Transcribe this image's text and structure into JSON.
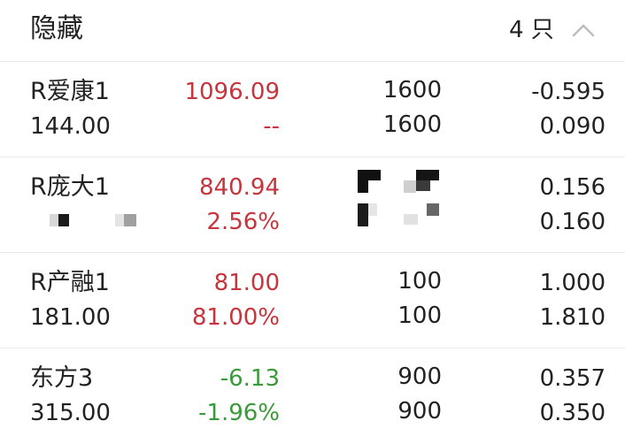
{
  "header": {
    "title": "隐藏",
    "count": "4 只",
    "collapse_icon": "chevron-up-icon"
  },
  "colors": {
    "up": "#c8343c",
    "down": "#3a9a3a",
    "text": "#222222",
    "divider": "#ececec"
  },
  "rows": [
    {
      "name": "R爱康1",
      "sub": "144.00",
      "price": "1096.09",
      "change": "--",
      "vol1": "1600",
      "vol2": "1600",
      "r1": "-0.595",
      "r2": "0.090",
      "trend": "up"
    },
    {
      "name": "R庞大1",
      "sub": "",
      "price": "840.94",
      "change": "2.56%",
      "vol1": "",
      "vol2": "",
      "r1": "0.156",
      "r2": "0.160",
      "trend": "up",
      "redacted": true
    },
    {
      "name": "R产融1",
      "sub": "181.00",
      "price": "81.00",
      "change": "81.00%",
      "vol1": "100",
      "vol2": "100",
      "r1": "1.000",
      "r2": "1.810",
      "trend": "up"
    },
    {
      "name": "东方3",
      "sub": "315.00",
      "price": "-6.13",
      "change": "-1.96%",
      "vol1": "900",
      "vol2": "900",
      "r1": "0.357",
      "r2": "0.350",
      "trend": "down"
    }
  ]
}
